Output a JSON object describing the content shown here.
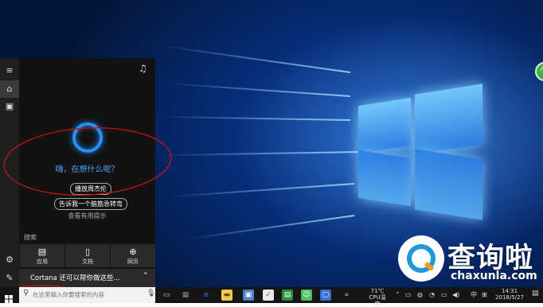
{
  "start_rail": {
    "items": [
      {
        "icon": "hamburger-icon",
        "glyph": "≡"
      },
      {
        "icon": "home-icon",
        "glyph": "⌂",
        "active": true
      },
      {
        "icon": "notebook-icon",
        "glyph": "▣"
      },
      {
        "icon": "settings-icon",
        "glyph": "⚙"
      },
      {
        "icon": "feedback-icon",
        "glyph": "✎"
      }
    ]
  },
  "cortana": {
    "greeting": "嗨，在想什么呢？",
    "suggestions": [
      "播放周杰伦",
      "告诉我一个脑筋急转弯"
    ],
    "more_tips": "查看有用提示",
    "search_heading": "搜索",
    "categories": [
      {
        "label": "应用",
        "glyph": "▤"
      },
      {
        "label": "文档",
        "glyph": "▯"
      },
      {
        "label": "网页",
        "glyph": "⊕"
      }
    ],
    "hint": "Cortana 还可以帮你做这些...",
    "hint_glyph": "⌃"
  },
  "taskbar": {
    "search_placeholder": "在这里输入你要搜索的内容",
    "temperature": "71℃",
    "cpu_label": "CPU温度",
    "ime": "中",
    "time": "14:31",
    "date": "2018/5/27"
  },
  "watermark": {
    "title": "查询啦",
    "url": "chaxunla.com"
  },
  "colors": {
    "accent": "#2d8ef0",
    "desktop_dark": "#031536",
    "panel": "#121212",
    "annotation": "#c0141a"
  }
}
